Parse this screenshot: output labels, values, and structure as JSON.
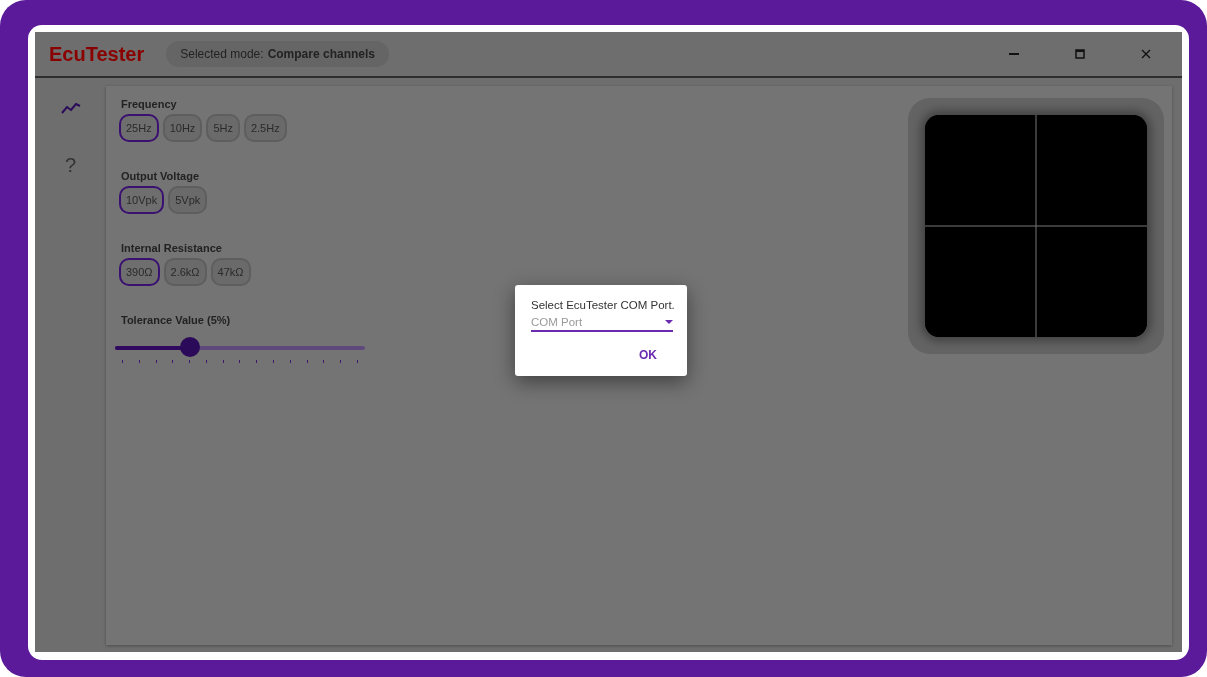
{
  "window": {
    "title": "EcuTester",
    "mode_label": "Selected mode:",
    "mode_value": "Compare channels"
  },
  "sidebar": {
    "items": [
      {
        "kind": "chart"
      },
      {
        "kind": "help",
        "label": "?"
      }
    ]
  },
  "groups": [
    {
      "label": "Frequency",
      "options": [
        {
          "label": "25Hz",
          "selected": true
        },
        {
          "label": "10Hz",
          "selected": false
        },
        {
          "label": "5Hz",
          "selected": false
        },
        {
          "label": "2.5Hz",
          "selected": false
        }
      ]
    },
    {
      "label": "Output Voltage",
      "options": [
        {
          "label": "10Vpk",
          "selected": true
        },
        {
          "label": "5Vpk",
          "selected": false
        }
      ]
    },
    {
      "label": "Internal Resistance",
      "options": [
        {
          "label": "390Ω",
          "selected": true
        },
        {
          "label": "2.6kΩ",
          "selected": false
        },
        {
          "label": "47kΩ",
          "selected": false
        }
      ]
    }
  ],
  "tolerance": {
    "label": "Tolerance Value (5%)",
    "level": 0.3
  },
  "dialog": {
    "message": "Select EcuTester COM Port.",
    "placeholder": "COM Port",
    "button": "OK"
  }
}
